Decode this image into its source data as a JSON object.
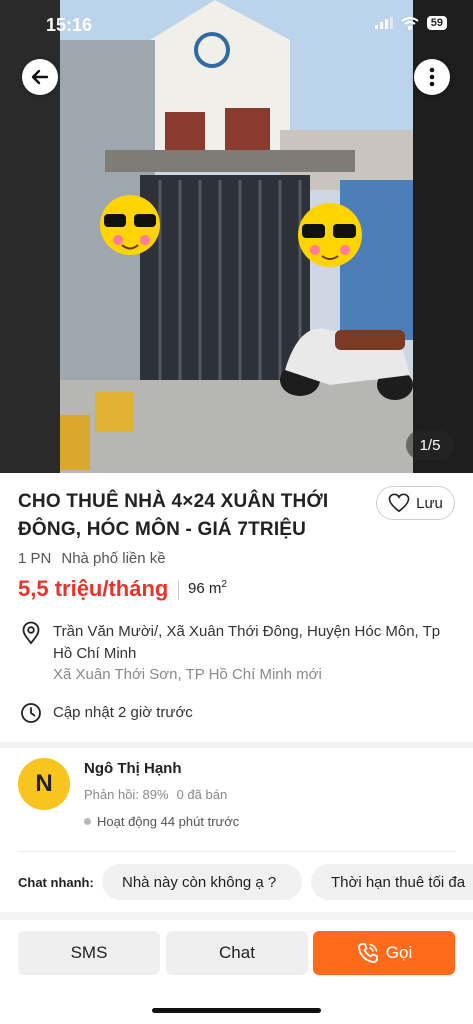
{
  "status_bar": {
    "time": "15:16",
    "battery": "59"
  },
  "gallery": {
    "counter": "1/5"
  },
  "listing": {
    "title": "CHO THUÊ NHÀ 4×24 XUÂN THỚI ĐÔNG, HÓC MÔN - GIÁ 7TRIỆU",
    "save_label": "Lưu",
    "bedrooms": "1 PN",
    "property_type": "Nhà phố liền kề",
    "price": "5,5 triệu/tháng",
    "area_value": "96 m",
    "area_unit_sup": "2",
    "address": "Trần Văn Mười/, Xã Xuân Thới Đông, Huyện Hóc Môn, Tp Hồ Chí Minh",
    "address_new": "Xã Xuân Thới Sơn, TP Hồ Chí Minh mới",
    "updated": "Cập nhật 2 giờ trước"
  },
  "seller": {
    "initial": "N",
    "name": "Ngô Thị Hạnh",
    "response_rate": "Phản hồi: 89%",
    "sold": "0 đã bán",
    "active": "Hoạt động 44 phút trước"
  },
  "quick_chat": {
    "label": "Chat nhanh:",
    "options": [
      "Nhà này còn không ạ ?",
      "Thời hạn thuê tối đa"
    ]
  },
  "actions": {
    "sms": "SMS",
    "chat": "Chat",
    "call": "Gọi"
  },
  "colors": {
    "price": "#e8352c",
    "call_button": "#ff6b1a",
    "avatar": "#f7c51e"
  }
}
